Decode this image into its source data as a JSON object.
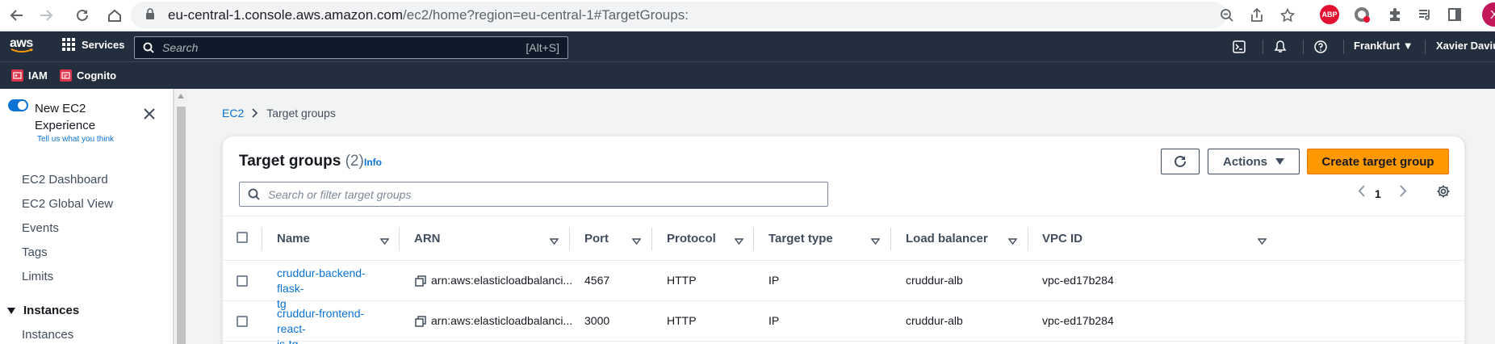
{
  "browser": {
    "url_host": "eu-central-1.console.aws.amazon.com",
    "url_path": "/ec2/home?region=eu-central-1#TargetGroups:",
    "ext_abp": "ABP",
    "profile_initial": "X"
  },
  "header": {
    "logo": "aws",
    "services_label": "Services",
    "search_placeholder": "Search",
    "search_shortcut": "[Alt+S]",
    "region": "Frankfurt",
    "user": "Xavier Daviu"
  },
  "favorites": [
    {
      "label": "IAM"
    },
    {
      "label": "Cognito"
    }
  ],
  "sidebar": {
    "new_experience_label": "New EC2 Experience",
    "feedback_link": "Tell us what you think",
    "items": [
      {
        "label": "EC2 Dashboard"
      },
      {
        "label": "EC2 Global View"
      },
      {
        "label": "Events"
      },
      {
        "label": "Tags"
      },
      {
        "label": "Limits"
      }
    ],
    "section": "Instances",
    "section_items": [
      {
        "label": "Instances"
      }
    ]
  },
  "breadcrumb": {
    "root": "EC2",
    "current": "Target groups"
  },
  "panel": {
    "title": "Target groups",
    "count": "(2)",
    "info": "Info",
    "actions_label": "Actions",
    "create_label": "Create target group",
    "filter_placeholder": "Search or filter target groups",
    "page": "1"
  },
  "table": {
    "columns": [
      "Name",
      "ARN",
      "Port",
      "Protocol",
      "Target type",
      "Load balancer",
      "VPC ID"
    ],
    "rows": [
      {
        "name_line1": "cruddur-backend-flask-",
        "name_line2": "tg",
        "arn": "arn:aws:elasticloadbalanci...",
        "port": "4567",
        "protocol": "HTTP",
        "target_type": "IP",
        "load_balancer": "cruddur-alb",
        "vpc_id": "vpc-ed17b284"
      },
      {
        "name_line1": "cruddur-frontend-react-",
        "name_line2": "js-tg",
        "arn": "arn:aws:elasticloadbalanci...",
        "port": "3000",
        "protocol": "HTTP",
        "target_type": "IP",
        "load_balancer": "cruddur-alb",
        "vpc_id": "vpc-ed17b284"
      }
    ]
  },
  "colors": {
    "header_bg": "#232f3e",
    "link": "#0972d3",
    "primary_button": "#ff9900"
  }
}
